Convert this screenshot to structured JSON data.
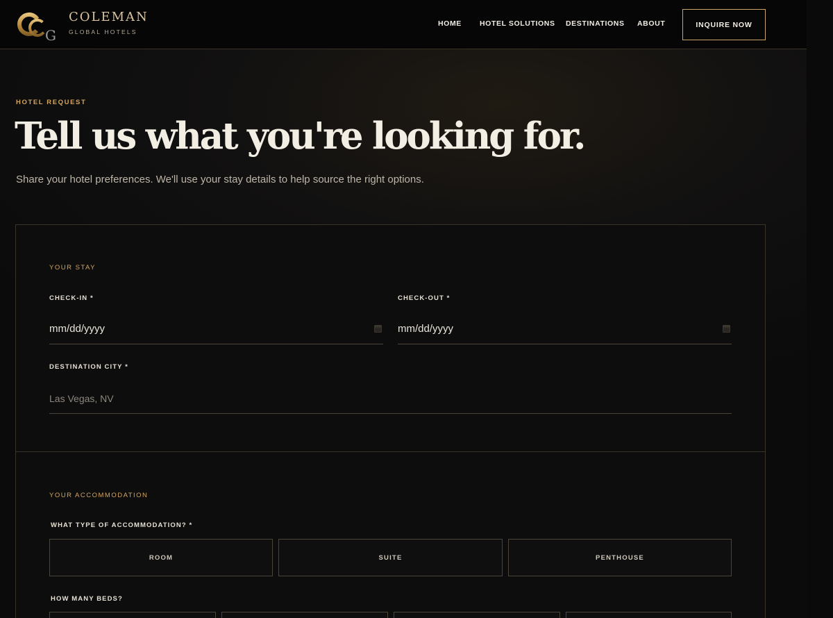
{
  "brand": {
    "name": "COLEMAN",
    "tagline": "GLOBAL HOTELS",
    "gold": "#d4a55c"
  },
  "nav": {
    "home": "HOME",
    "hotel_solutions": "HOTEL SOLUTIONS",
    "destinations": "DESTINATIONS",
    "about": "ABOUT",
    "cta": "INQUIRE NOW"
  },
  "hero": {
    "eyebrow": "HOTEL REQUEST",
    "title": "Tell us what you're looking for.",
    "subtitle": "Share your hotel preferences. We'll use your stay details to help source the right options."
  },
  "stay": {
    "section": "YOUR STAY",
    "checkin_label": "CHECK-IN *",
    "checkin_value": "mm/dd/yyyy",
    "checkout_label": "CHECK-OUT *",
    "checkout_value": "mm/dd/yyyy",
    "city_label": "DESTINATION CITY *",
    "city_placeholder": "Las Vegas, NV"
  },
  "accommodation": {
    "section": "YOUR ACCOMMODATION",
    "type_label": "WHAT TYPE OF ACCOMMODATION? *",
    "types": [
      "ROOM",
      "SUITE",
      "PENTHOUSE"
    ],
    "beds_label": "HOW MANY BEDS?"
  }
}
